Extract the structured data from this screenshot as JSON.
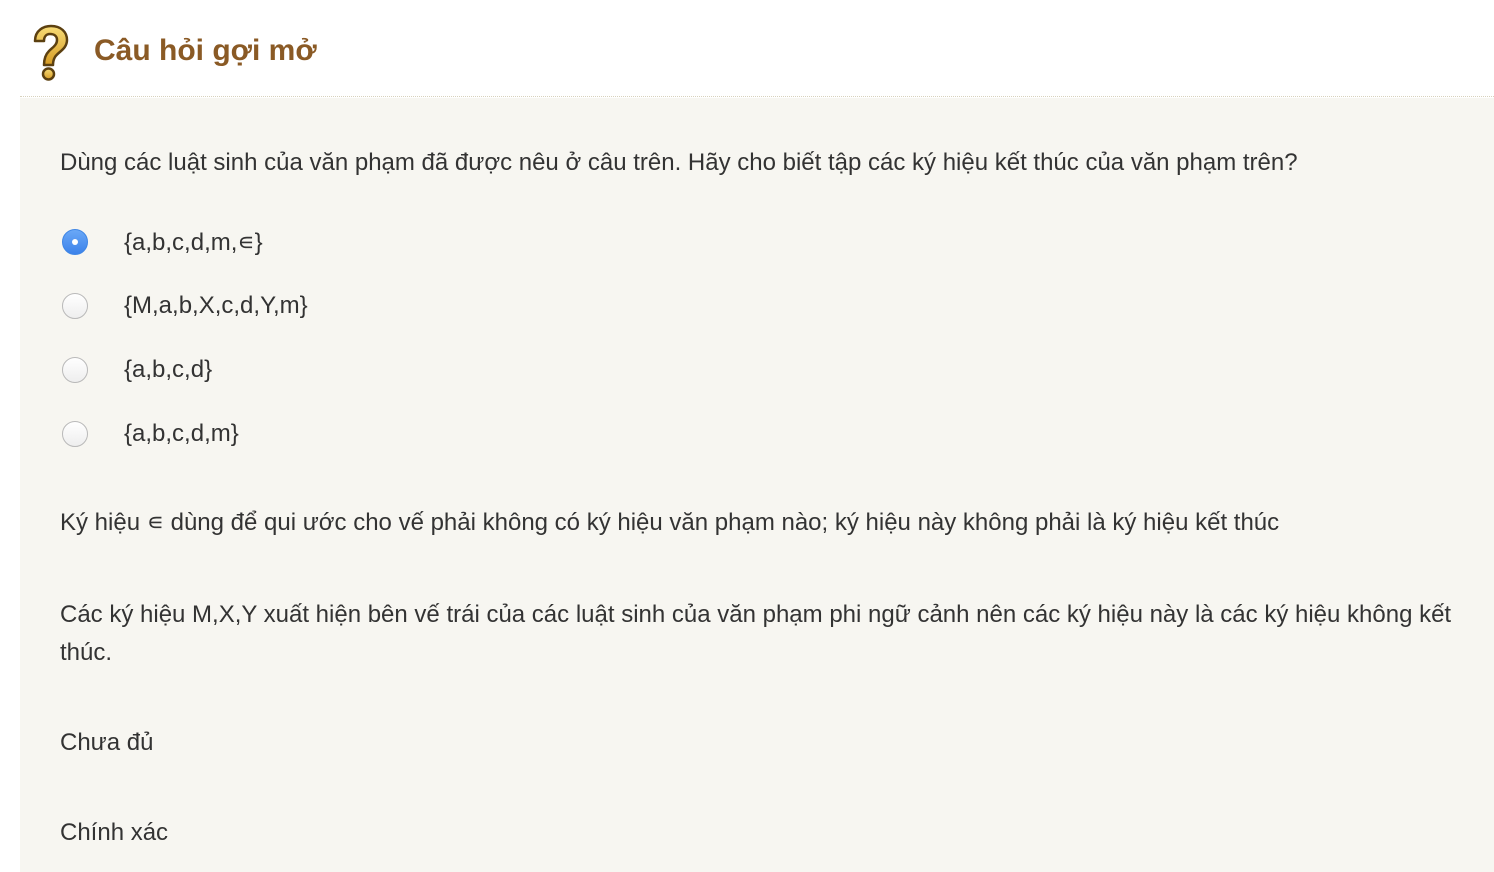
{
  "header": {
    "icon": "question-mark-icon",
    "title": "Câu hỏi gợi mở"
  },
  "question": {
    "text": "Dùng các luật sinh của văn phạm đã được nêu ở câu trên. Hãy cho biết tập các ký hiệu kết thúc của văn phạm trên?"
  },
  "options": [
    {
      "label": "{a,b,c,d,m,∊}",
      "selected": true
    },
    {
      "label": "{M,a,b,X,c,d,Y,m}",
      "selected": false
    },
    {
      "label": "{a,b,c,d}",
      "selected": false
    },
    {
      "label": "{a,b,c,d,m}",
      "selected": false
    }
  ],
  "feedback": [
    "Ký hiệu ∊ dùng để qui ước cho vế phải không có ký hiệu văn phạm nào; ký hiệu này không phải là ký hiệu kết thúc",
    "Các ký hiệu M,X,Y xuất hiện bên vế trái của các luật sinh của văn phạm phi ngữ cảnh nên các ký hiệu này là các ký hiệu không kết thúc."
  ],
  "status": [
    "Chưa đủ",
    "Chính xác"
  ],
  "colors": {
    "title": "#8a5a25",
    "icon": "#e3b83a",
    "background": "#f7f6f1",
    "radio_selected": "#3b82ea"
  }
}
